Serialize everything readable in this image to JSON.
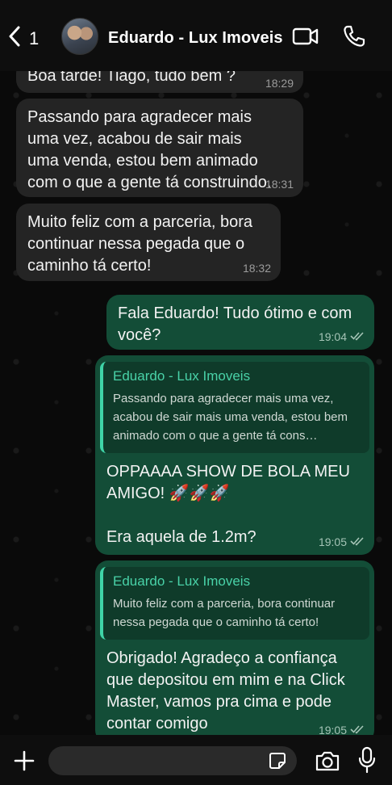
{
  "header": {
    "back_count": "1",
    "contact_name": "Eduardo - Lux Imoveis",
    "icons": [
      "chevron-left-icon",
      "video-call-icon",
      "phone-icon"
    ]
  },
  "messages": [
    {
      "direction": "incoming",
      "text": "Boa tarde! Tiago, tudo bem ?",
      "time": "18:29"
    },
    {
      "direction": "incoming",
      "text": "Passando para agradecer mais uma vez, acabou de sair mais uma venda, estou bem animado com o que a gente tá construindo.",
      "time": "18:31"
    },
    {
      "direction": "incoming",
      "text": "Muito feliz com a parceria, bora continuar nessa pegada que o caminho tá certo!",
      "time": "18:32"
    },
    {
      "direction": "outgoing",
      "text": "Fala Eduardo! Tudo ótimo e com você?",
      "time": "19:04"
    },
    {
      "direction": "outgoing",
      "reply_name": "Eduardo - Lux Imoveis",
      "reply_text": "Passando para agradecer mais uma vez, acabou de sair mais uma venda, estou bem animado com o que a gente tá cons…",
      "text_line1": "OPPAAAA SHOW DE BOLA MEU AMIGO! 🚀🚀🚀",
      "text_line2": "Era aquela de 1.2m?",
      "time": "19:05"
    },
    {
      "direction": "outgoing",
      "reply_name": "Eduardo - Lux Imoveis",
      "reply_text": "Muito feliz com a parceria, bora continuar nessa pegada que o caminho tá certo!",
      "text": "Obrigado! Agradeço a confiança que depositou em mim e na Click Master, vamos pra cima e pode contar comigo",
      "time": "19:05"
    }
  ],
  "composer": {
    "icons": [
      "plus-icon",
      "sticker-icon",
      "camera-icon",
      "microphone-icon"
    ],
    "placeholder": ""
  },
  "colors": {
    "incoming_bubble": "#242424",
    "outgoing_bubble": "#134d37",
    "reply_accent": "#49d2a8",
    "background": "#0a0a0a"
  }
}
